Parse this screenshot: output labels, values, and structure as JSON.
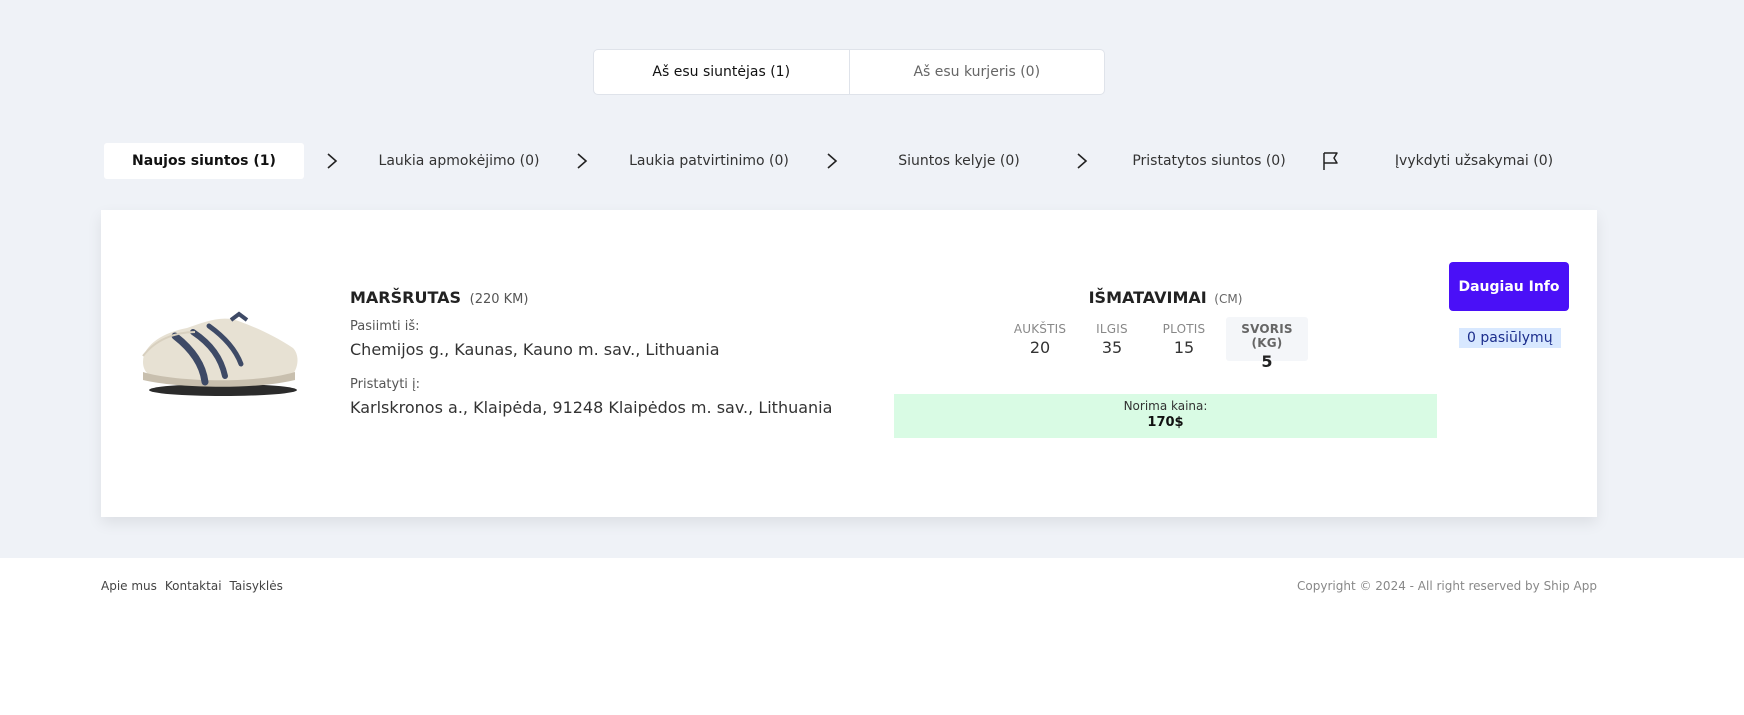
{
  "role_tabs": [
    {
      "label": "Aš esu siuntėjas (1)"
    },
    {
      "label": "Aš esu kurjeris (0)"
    }
  ],
  "steps": [
    {
      "label": "Naujos siuntos (1)",
      "active": true
    },
    {
      "label": "Laukia apmokėjimo (0)"
    },
    {
      "label": "Laukia patvirtinimo (0)"
    },
    {
      "label": "Siuntos kelyje (0)"
    },
    {
      "label": "Pristatytos siuntos (0)"
    },
    {
      "label": "Įvykdyti užsakymai (0)"
    }
  ],
  "shipment": {
    "route_title": "MARŠRUTAS",
    "route_distance": "(220 KM)",
    "pickup_label": "Pasiimti iš:",
    "pickup_address": "Chemijos g., Kaunas, Kauno m. sav., Lithuania",
    "delivery_label": "Pristatyti į:",
    "delivery_address": "Karlskronos a., Klaipėda, 91248 Klaipėdos m. sav., Lithuania",
    "measure_title": "IŠMATAVIMAI",
    "measure_unit": "(CM)",
    "dims": [
      {
        "label": "AUKŠTIS",
        "value": "20"
      },
      {
        "label": "ILGIS",
        "value": "35"
      },
      {
        "label": "PLOTIS",
        "value": "15"
      }
    ],
    "weight": {
      "label": "SVORIS (KG)",
      "value": "5"
    },
    "price_label": "Norima kaina:",
    "price_value": "170$",
    "info_button": "Daugiau Info",
    "offers": "0 pasiūlymų"
  },
  "footer": {
    "links": [
      "Apie mus",
      "Kontaktai",
      "Taisyklės"
    ],
    "copyright": "Copyright © 2024 - All right reserved by Ship App"
  },
  "colors": {
    "accent": "#4a10f7",
    "background": "#eff2f7",
    "price_bg": "#d9fbe4",
    "offers_bg": "#d8e8ff"
  }
}
